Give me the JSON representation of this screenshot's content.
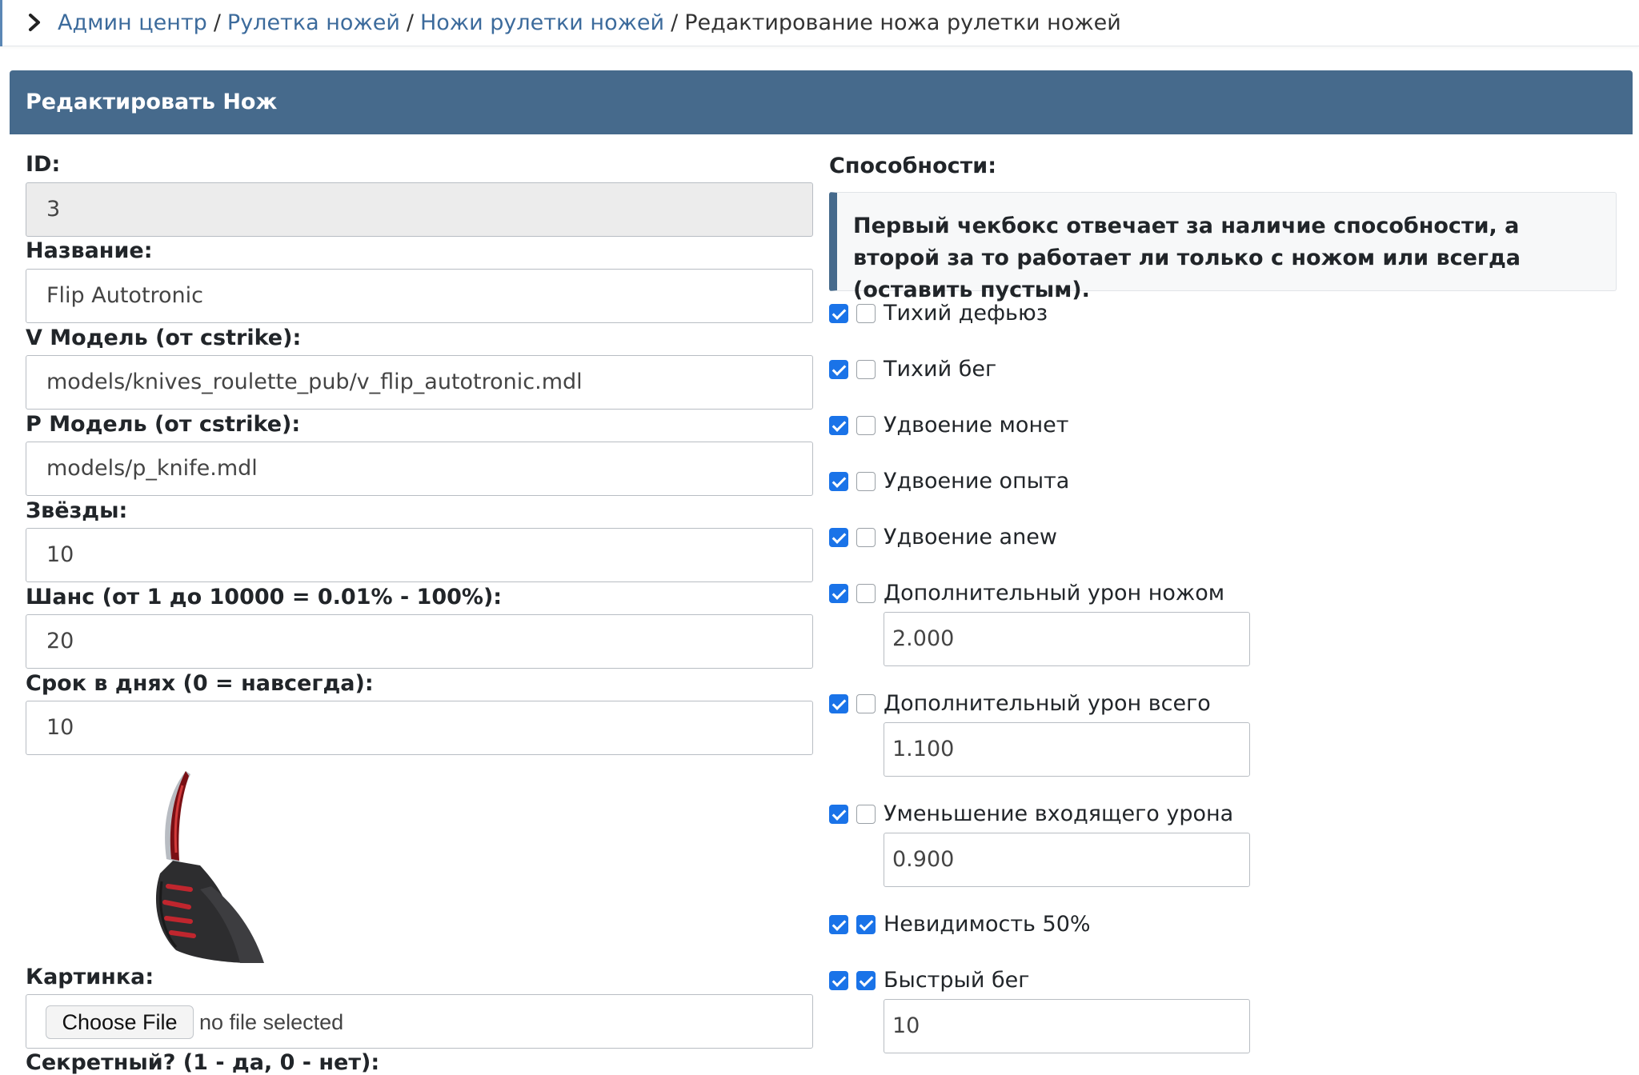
{
  "breadcrumb": {
    "items": [
      "Админ центр",
      "Рулетка ножей",
      "Ножи рулетки ножей"
    ],
    "current": "Редактирование ножа рулетки ножей",
    "separator": "/"
  },
  "card": {
    "title": "Редактировать Нож"
  },
  "form": {
    "id": {
      "label": "ID:",
      "value": "3"
    },
    "name": {
      "label": "Название:",
      "value": "Flip Autotronic"
    },
    "v_model": {
      "label": "V Модель (от cstrike):",
      "value": "models/knives_roulette_pub/v_flip_autotronic.mdl"
    },
    "p_model": {
      "label": "P Модель (от cstrike):",
      "value": "models/p_knife.mdl"
    },
    "stars": {
      "label": "Звёзды:",
      "value": "10"
    },
    "chance": {
      "label": "Шанс (от 1 до 10000 = 0.01% - 100%):",
      "value": "20"
    },
    "term": {
      "label": "Срок в днях (0 = навсегда):",
      "value": "10"
    },
    "image": {
      "label": "Картинка:",
      "button": "Choose File",
      "status": "no file selected"
    },
    "secret": {
      "label": "Секретный? (1 - да, 0 - нет):"
    }
  },
  "abilities": {
    "title": "Способности:",
    "note": "Первый чекбокс отвечает за наличие способности, а второй за то работает ли только с ножом или всегда (оставить пустым).",
    "items": [
      {
        "label": "Тихий дефьюз",
        "enabled": true,
        "always": false
      },
      {
        "label": "Тихий бег",
        "enabled": true,
        "always": false
      },
      {
        "label": "Удвоение монет",
        "enabled": true,
        "always": false
      },
      {
        "label": "Удвоение опыта",
        "enabled": true,
        "always": false
      },
      {
        "label": "Удвоение anew",
        "enabled": true,
        "always": false
      },
      {
        "label": "Дополнительный урон ножом",
        "enabled": true,
        "always": false,
        "value": "2.000"
      },
      {
        "label": "Дополнительный урон всего",
        "enabled": true,
        "always": false,
        "value": "1.100"
      },
      {
        "label": "Уменьшение входящего урона",
        "enabled": true,
        "always": false,
        "value": "0.900"
      },
      {
        "label": "Невидимость 50%",
        "enabled": true,
        "always": true
      },
      {
        "label": "Быстрый бег",
        "enabled": true,
        "always": true,
        "value": "10"
      }
    ]
  },
  "colors": {
    "header_bg": "#466a8c",
    "link": "#3c6b9c",
    "checkbox_checked": "#1a73e8"
  }
}
